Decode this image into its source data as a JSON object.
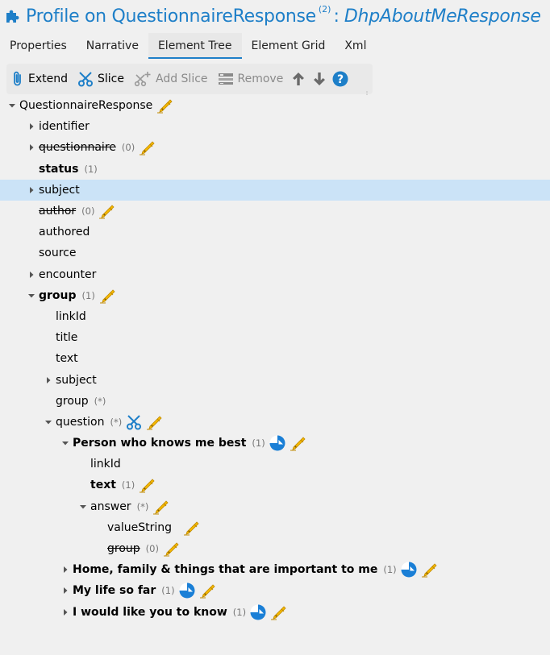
{
  "header": {
    "title": "Profile on QuestionnaireResponse",
    "superscript": "(2)",
    "separator": ":",
    "profile_name": "DhpAboutMeResponse"
  },
  "tabs": [
    {
      "label": "Properties",
      "active": false
    },
    {
      "label": "Narrative",
      "active": false
    },
    {
      "label": "Element Tree",
      "active": true
    },
    {
      "label": "Element Grid",
      "active": false
    },
    {
      "label": "Xml",
      "active": false
    }
  ],
  "toolbar": {
    "extend_label": "Extend",
    "slice_label": "Slice",
    "add_slice_label": "Add Slice",
    "remove_label": "Remove"
  },
  "colors": {
    "accent": "#1e7fc8",
    "selection": "#cbe3f7",
    "pen": "#f5b800",
    "slice_blue": "#1a7fd6"
  },
  "tree": [
    {
      "label": "QuestionnaireResponse",
      "card": "",
      "level": 0,
      "arrow": "down",
      "bold": false,
      "strike": false,
      "selected": false,
      "icons": [
        "pen"
      ]
    },
    {
      "label": "identifier",
      "card": "",
      "level": 1,
      "arrow": "right",
      "bold": false,
      "strike": false,
      "selected": false,
      "icons": []
    },
    {
      "label": "questionnaire",
      "card": "(0)",
      "level": 1,
      "arrow": "right",
      "bold": false,
      "strike": true,
      "selected": false,
      "icons": [
        "pen"
      ]
    },
    {
      "label": "status",
      "card": "(1)",
      "level": 1,
      "arrow": "none",
      "bold": true,
      "strike": false,
      "selected": false,
      "icons": []
    },
    {
      "label": "subject",
      "card": "",
      "level": 1,
      "arrow": "right",
      "bold": false,
      "strike": false,
      "selected": true,
      "icons": []
    },
    {
      "label": "author",
      "card": "(0)",
      "level": 1,
      "arrow": "none",
      "bold": false,
      "strike": true,
      "selected": false,
      "icons": [
        "pen"
      ]
    },
    {
      "label": "authored",
      "card": "",
      "level": 1,
      "arrow": "none",
      "bold": false,
      "strike": false,
      "selected": false,
      "icons": []
    },
    {
      "label": "source",
      "card": "",
      "level": 1,
      "arrow": "none",
      "bold": false,
      "strike": false,
      "selected": false,
      "icons": []
    },
    {
      "label": "encounter",
      "card": "",
      "level": 1,
      "arrow": "right",
      "bold": false,
      "strike": false,
      "selected": false,
      "icons": []
    },
    {
      "label": "group",
      "card": "(1)",
      "level": 1,
      "arrow": "down",
      "bold": true,
      "strike": false,
      "selected": false,
      "icons": [
        "pen"
      ]
    },
    {
      "label": "linkId",
      "card": "",
      "level": 2,
      "arrow": "none",
      "bold": false,
      "strike": false,
      "selected": false,
      "icons": []
    },
    {
      "label": "title",
      "card": "",
      "level": 2,
      "arrow": "none",
      "bold": false,
      "strike": false,
      "selected": false,
      "icons": []
    },
    {
      "label": "text",
      "card": "",
      "level": 2,
      "arrow": "none",
      "bold": false,
      "strike": false,
      "selected": false,
      "icons": []
    },
    {
      "label": "subject",
      "card": "",
      "level": 2,
      "arrow": "right",
      "bold": false,
      "strike": false,
      "selected": false,
      "icons": []
    },
    {
      "label": "group",
      "card": "(*)",
      "level": 2,
      "arrow": "none",
      "bold": false,
      "strike": false,
      "selected": false,
      "icons": []
    },
    {
      "label": "question",
      "card": "(*)",
      "level": 2,
      "arrow": "down",
      "bold": false,
      "strike": false,
      "selected": false,
      "icons": [
        "scissors",
        "pen"
      ]
    },
    {
      "label": "Person who knows me best",
      "card": "(1)",
      "level": 3,
      "arrow": "down",
      "bold": true,
      "strike": false,
      "selected": false,
      "icons": [
        "slice",
        "pen"
      ]
    },
    {
      "label": "linkId",
      "card": "",
      "level": 4,
      "arrow": "none",
      "bold": false,
      "strike": false,
      "selected": false,
      "icons": []
    },
    {
      "label": "text",
      "card": "(1)",
      "level": 4,
      "arrow": "none",
      "bold": true,
      "strike": false,
      "selected": false,
      "icons": [
        "pen"
      ]
    },
    {
      "label": "answer",
      "card": "(*)",
      "level": 4,
      "arrow": "down",
      "bold": false,
      "strike": false,
      "selected": false,
      "icons": [
        "pen"
      ]
    },
    {
      "label": "valueString",
      "card": "",
      "level": 5,
      "arrow": "none",
      "bold": false,
      "strike": false,
      "selected": false,
      "icons": [
        "pen-spaced"
      ]
    },
    {
      "label": "group",
      "card": "(0)",
      "level": 5,
      "arrow": "none",
      "bold": false,
      "strike": true,
      "selected": false,
      "icons": [
        "pen"
      ]
    },
    {
      "label": "Home, family & things that are important to me",
      "card": "(1)",
      "level": 3,
      "arrow": "right",
      "bold": true,
      "strike": false,
      "selected": false,
      "icons": [
        "slice",
        "pen"
      ]
    },
    {
      "label": "My life so far",
      "card": "(1)",
      "level": 3,
      "arrow": "right",
      "bold": true,
      "strike": false,
      "selected": false,
      "icons": [
        "slice",
        "pen"
      ]
    },
    {
      "label": "I would like you to know",
      "card": "(1)",
      "level": 3,
      "arrow": "right",
      "bold": true,
      "strike": false,
      "selected": false,
      "icons": [
        "slice",
        "pen"
      ]
    }
  ]
}
